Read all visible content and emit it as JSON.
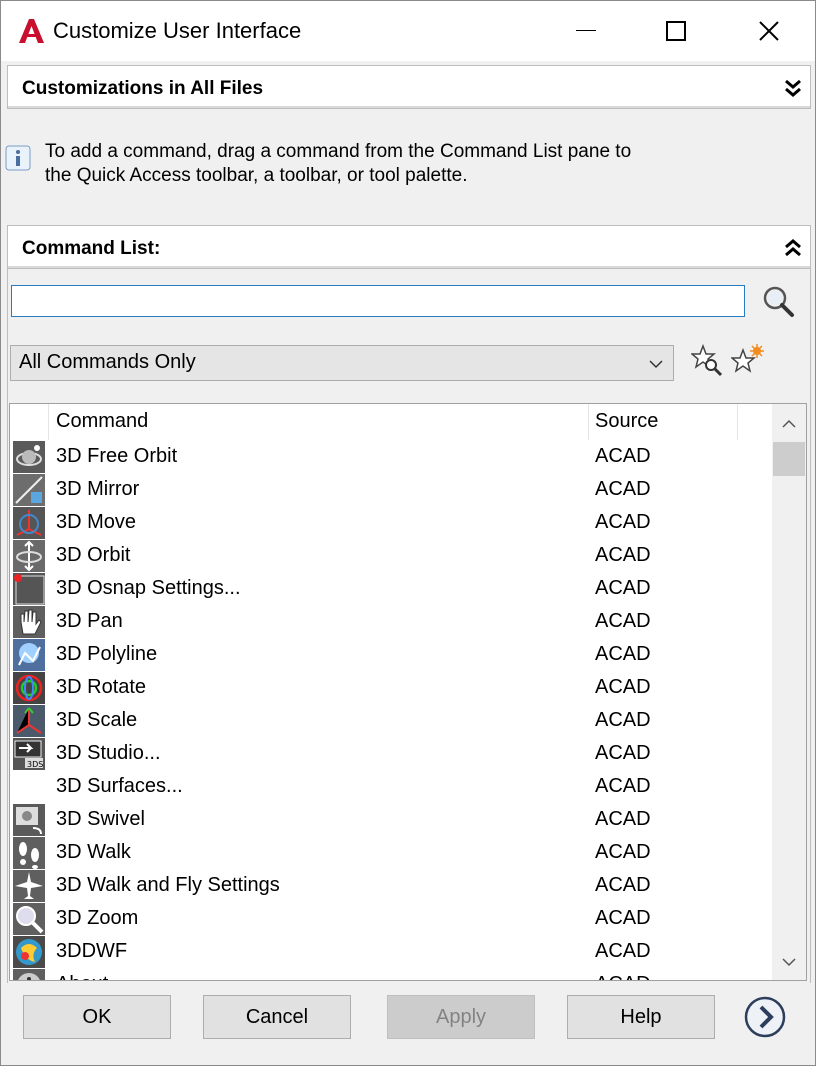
{
  "window": {
    "title": "Customize User Interface"
  },
  "customizations": {
    "header": "Customizations in All Files"
  },
  "info": {
    "line1": "To add a command, drag a command from the Command List pane to",
    "line2": "the Quick Access toolbar, a toolbar, or tool palette."
  },
  "command_list": {
    "header": "Command List:",
    "search_value": "",
    "filter_selected": "All Commands Only",
    "columns": {
      "command": "Command",
      "source": "Source"
    },
    "rows": [
      {
        "command": "3D Free Orbit",
        "source": "ACAD",
        "icon": "free-orbit-icon"
      },
      {
        "command": "3D Mirror",
        "source": "ACAD",
        "icon": "mirror-icon"
      },
      {
        "command": "3D Move",
        "source": "ACAD",
        "icon": "move-icon"
      },
      {
        "command": "3D Orbit",
        "source": "ACAD",
        "icon": "orbit-icon"
      },
      {
        "command": "3D Osnap Settings...",
        "source": "ACAD",
        "icon": "osnap-icon"
      },
      {
        "command": "3D Pan",
        "source": "ACAD",
        "icon": "hand-icon"
      },
      {
        "command": "3D Polyline",
        "source": "ACAD",
        "icon": "polyline-icon"
      },
      {
        "command": "3D Rotate",
        "source": "ACAD",
        "icon": "rotate-icon"
      },
      {
        "command": "3D Scale",
        "source": "ACAD",
        "icon": "scale-icon"
      },
      {
        "command": "3D Studio...",
        "source": "ACAD",
        "icon": "studio-icon"
      },
      {
        "command": "3D Surfaces...",
        "source": "ACAD",
        "icon": ""
      },
      {
        "command": "3D Swivel",
        "source": "ACAD",
        "icon": "swivel-icon"
      },
      {
        "command": "3D Walk",
        "source": "ACAD",
        "icon": "footprints-icon"
      },
      {
        "command": "3D Walk and Fly Settings",
        "source": "ACAD",
        "icon": "walk-fly-icon"
      },
      {
        "command": "3D Zoom",
        "source": "ACAD",
        "icon": "zoom-icon"
      },
      {
        "command": "3DDWF",
        "source": "ACAD",
        "icon": "dwf-icon"
      },
      {
        "command": "About",
        "source": "ACAD",
        "icon": "about-icon"
      }
    ]
  },
  "buttons": {
    "ok": "OK",
    "cancel": "Cancel",
    "apply": "Apply",
    "help": "Help"
  },
  "colors": {
    "accent": "#2a7abf",
    "logo_red": "#c8102e"
  }
}
